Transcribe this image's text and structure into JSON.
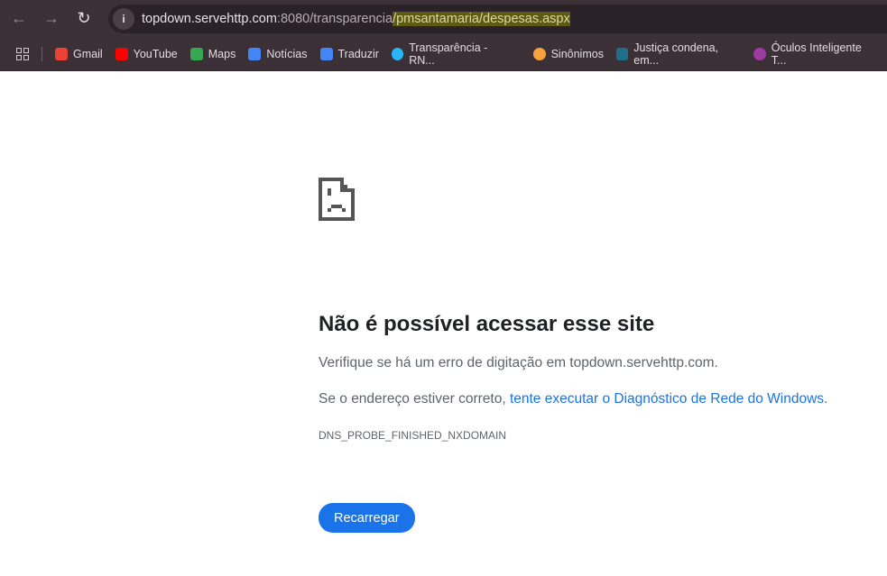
{
  "browser": {
    "url_host": "topdown.servehttp.com",
    "url_port_path": ":8080/transparencia",
    "url_highlighted": "/pmsantamaria/despesas.aspx",
    "bookmarks": [
      {
        "label": "Gmail",
        "icon": "gmail-icon",
        "color": "#ea4335"
      },
      {
        "label": "YouTube",
        "icon": "youtube-icon",
        "color": "#ff0000"
      },
      {
        "label": "Maps",
        "icon": "maps-icon",
        "color": "#34a853"
      },
      {
        "label": "Notícias",
        "icon": "news-icon",
        "color": "#4285f4"
      },
      {
        "label": "Traduzir",
        "icon": "translate-icon",
        "color": "#4285f4"
      },
      {
        "label": "Transparência - RN...",
        "icon": "transparency-icon",
        "color": "#29b6f6"
      },
      {
        "label": "Sinônimos",
        "icon": "synonyms-icon",
        "color": "#f9a03f"
      },
      {
        "label": "Justiça condena, em...",
        "icon": "justice-icon",
        "color": "#1d6f8a"
      },
      {
        "label": "Óculos Inteligente T...",
        "icon": "glasses-icon",
        "color": "#9c3aa0"
      }
    ]
  },
  "error": {
    "title": "Não é possível acessar esse site",
    "line1": "Verifique se há um erro de digitação em topdown.servehttp.com.",
    "line2_prefix": "Se o endereço estiver correto, ",
    "line2_link": "tente executar o Diagnóstico de Rede do Windows",
    "line2_suffix": ".",
    "code": "DNS_PROBE_FINISHED_NXDOMAIN",
    "reload_label": "Recarregar"
  }
}
